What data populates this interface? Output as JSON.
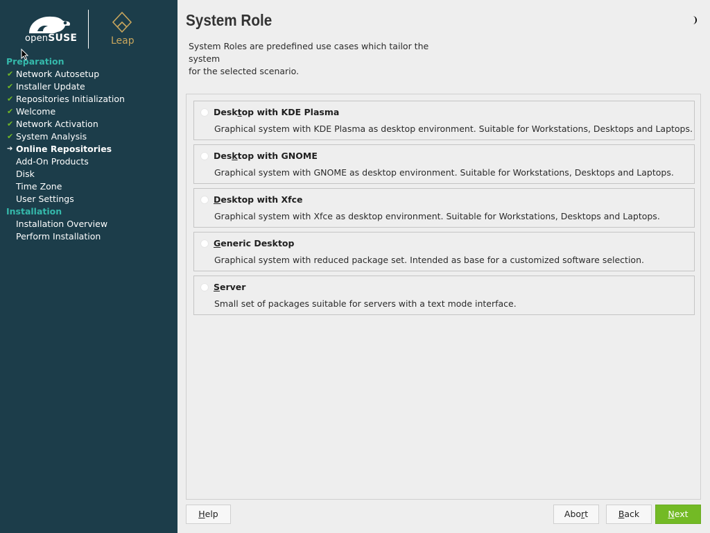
{
  "branding": {
    "opensuse_prefix": "open",
    "opensuse_suffix": "SUSE",
    "product": "Leap"
  },
  "sidebar": {
    "sections": [
      {
        "title": "Preparation",
        "steps": [
          {
            "label": "Network Autosetup",
            "state": "done"
          },
          {
            "label": "Installer Update",
            "state": "done"
          },
          {
            "label": "Repositories Initialization",
            "state": "done"
          },
          {
            "label": "Welcome",
            "state": "done"
          },
          {
            "label": "Network Activation",
            "state": "done"
          },
          {
            "label": "System Analysis",
            "state": "done"
          },
          {
            "label": "Online Repositories",
            "state": "current"
          },
          {
            "label": "Add-On Products",
            "state": "pending"
          },
          {
            "label": "Disk",
            "state": "pending"
          },
          {
            "label": "Time Zone",
            "state": "pending"
          },
          {
            "label": "User Settings",
            "state": "pending"
          }
        ]
      },
      {
        "title": "Installation",
        "steps": [
          {
            "label": "Installation Overview",
            "state": "pending"
          },
          {
            "label": "Perform Installation",
            "state": "pending"
          }
        ]
      }
    ]
  },
  "main": {
    "title": "System Role",
    "description_line1": "System Roles are predefined use cases which tailor the system",
    "description_line2": "for the selected scenario.",
    "roles": [
      {
        "pre": "Desk",
        "hot": "t",
        "post": "op with KDE Plasma",
        "description": "Graphical system with KDE Plasma as desktop environment. Suitable for Workstations, Desktops and Laptops."
      },
      {
        "pre": "Des",
        "hot": "k",
        "post": "top with GNOME",
        "description": "Graphical system with GNOME as desktop environment. Suitable for Workstations, Desktops and Laptops."
      },
      {
        "pre": "",
        "hot": "D",
        "post": "esktop with Xfce",
        "description": "Graphical system with Xfce as desktop environment. Suitable for Workstations, Desktops and Laptops."
      },
      {
        "pre": "",
        "hot": "G",
        "post": "eneric Desktop",
        "description": "Graphical system with reduced package set. Intended as base for a customized software selection."
      },
      {
        "pre": "",
        "hot": "S",
        "post": "erver",
        "description": "Small set of packages suitable for servers with a text mode interface."
      }
    ]
  },
  "buttons": {
    "help": {
      "hot": "H",
      "rest": "elp"
    },
    "abort": {
      "pre": "Abo",
      "hot": "r",
      "post": "t"
    },
    "back": {
      "hot": "B",
      "rest": "ack"
    },
    "next": {
      "hot": "N",
      "rest": "ext"
    }
  },
  "colors": {
    "sidebar_bg": "#1c3d4a",
    "section_title": "#35b9ab",
    "check": "#73ba25",
    "next_button": "#73ba25",
    "leap_gold": "#c9a75d"
  },
  "icons": {
    "done": "check-icon",
    "current": "arrow-right-icon",
    "theme_toggle": "moon-icon"
  }
}
